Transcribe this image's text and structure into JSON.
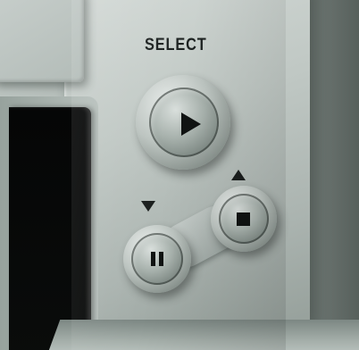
{
  "device": {
    "select_label": "SELECT",
    "buttons": [
      {
        "name": "play",
        "icon": "play-icon"
      },
      {
        "name": "stop",
        "icon": "stop-icon"
      },
      {
        "name": "pause",
        "icon": "pause-icon"
      }
    ],
    "indicators": [
      "triangle-down-icon",
      "triangle-up-icon"
    ],
    "colors": {
      "panel": "#c0c8c4",
      "glyph": "#101312",
      "window": "#070808"
    }
  }
}
